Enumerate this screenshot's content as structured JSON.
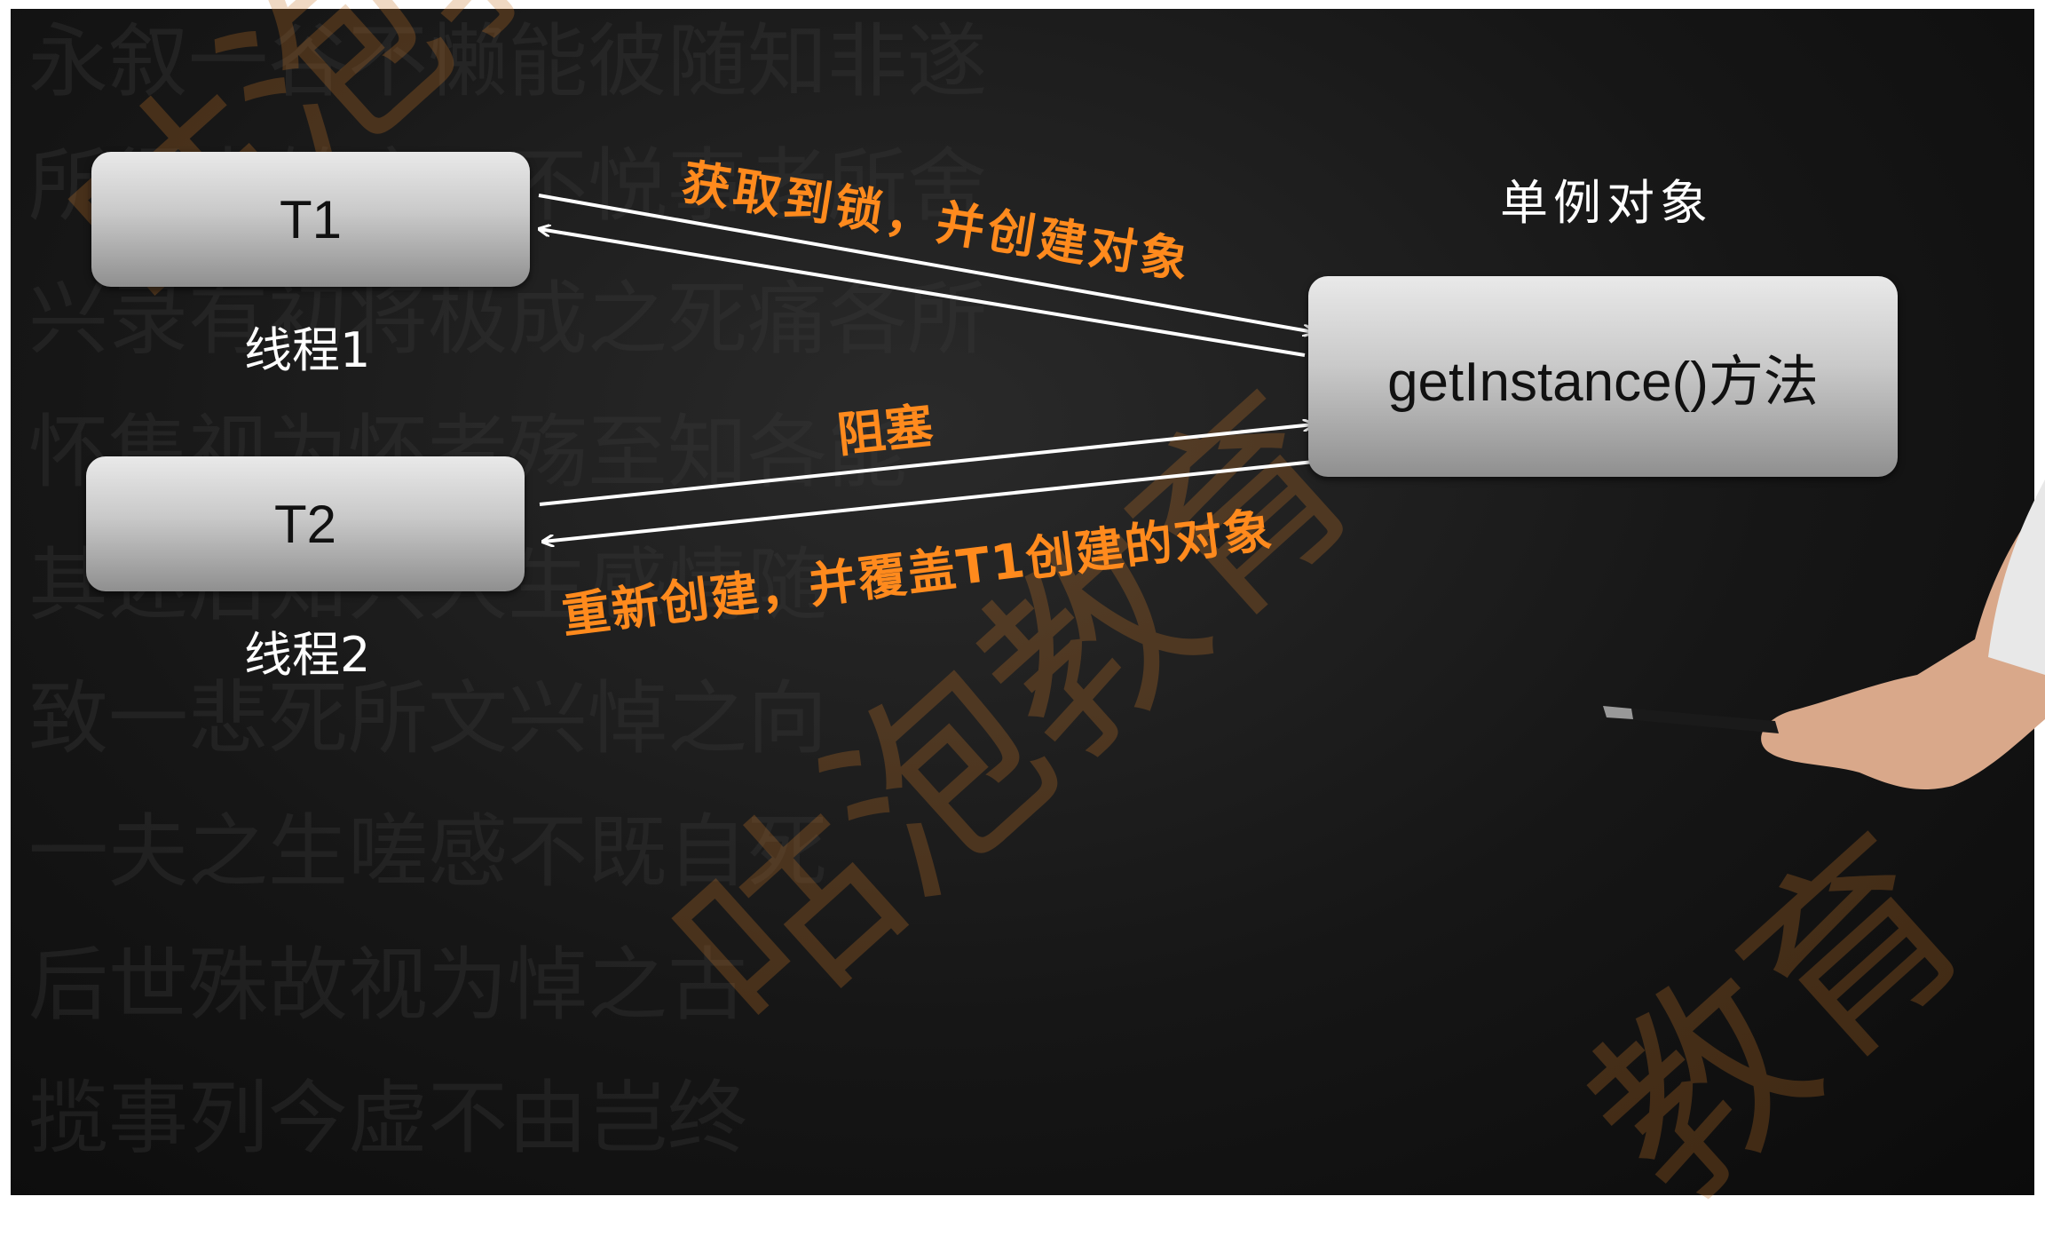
{
  "diagram": {
    "nodes": {
      "t1": "T1",
      "t2": "T2",
      "method": "getInstance()方法"
    },
    "labels": {
      "thread1": "线程1",
      "thread2": "线程2",
      "singleton": "单例对象"
    },
    "edges": {
      "acquire": "获取到锁，并创建对象",
      "block": "阻塞",
      "recreate": "重新创建，并覆盖T1创建的对象"
    }
  },
  "watermark": [
    "咕泡教育",
    "咕泡教育",
    "教育"
  ],
  "colors": {
    "background": "#141414",
    "box": "#c9c9c9",
    "edge_label": "#ff8a1d",
    "arrow": "#ffffff"
  }
}
